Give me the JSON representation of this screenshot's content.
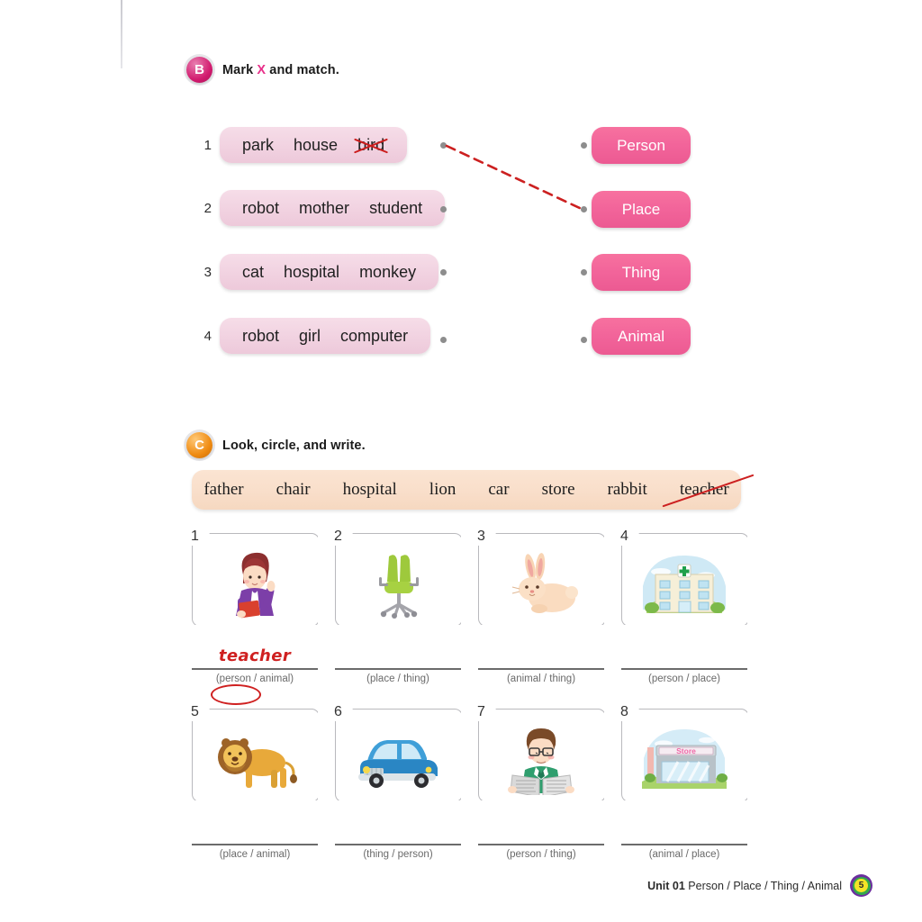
{
  "section_b": {
    "badge": "B",
    "title_before": "Mark ",
    "title_x": "X",
    "title_after": " and match.",
    "rows": [
      {
        "num": "1",
        "words": [
          "park",
          "house",
          "bird"
        ],
        "struck_index": 2
      },
      {
        "num": "2",
        "words": [
          "robot",
          "mother",
          "student"
        ],
        "struck_index": -1
      },
      {
        "num": "3",
        "words": [
          "cat",
          "hospital",
          "monkey"
        ],
        "struck_index": -1
      },
      {
        "num": "4",
        "words": [
          "robot",
          "girl",
          "computer"
        ],
        "struck_index": -1
      }
    ],
    "categories": [
      "Person",
      "Place",
      "Thing",
      "Animal"
    ],
    "match_color": "#cc2020"
  },
  "section_c": {
    "badge": "C",
    "title": "Look, circle, and write.",
    "wordbank": [
      "father",
      "chair",
      "hospital",
      "lion",
      "car",
      "store",
      "rabbit",
      "teacher"
    ],
    "wordbank_struck": "teacher",
    "items": [
      {
        "num": "1",
        "art": "teacher-woman",
        "answer": "teacher",
        "options": "(person / animal)",
        "circled": "person"
      },
      {
        "num": "2",
        "art": "office-chair",
        "answer": "",
        "options": "(place / thing)",
        "circled": ""
      },
      {
        "num": "3",
        "art": "rabbit",
        "answer": "",
        "options": "(animal / thing)",
        "circled": ""
      },
      {
        "num": "4",
        "art": "hospital-building",
        "answer": "",
        "options": "(person / place)",
        "circled": ""
      },
      {
        "num": "5",
        "art": "lion",
        "answer": "",
        "options": "(place / animal)",
        "circled": ""
      },
      {
        "num": "6",
        "art": "blue-car",
        "answer": "",
        "options": "(thing / person)",
        "circled": ""
      },
      {
        "num": "7",
        "art": "man-reading-newspaper",
        "answer": "",
        "options": "(person / thing)",
        "circled": ""
      },
      {
        "num": "8",
        "art": "store-building",
        "answer": "",
        "options": "(animal / place)",
        "circled": ""
      }
    ]
  },
  "footer": {
    "unit": "Unit 01",
    "topic": " Person / Place / Thing / Animal",
    "page": "5"
  }
}
